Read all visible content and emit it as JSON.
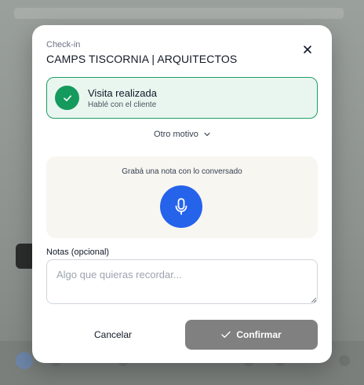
{
  "modal": {
    "eyebrow": "Check-in",
    "title": "CAMPS TISCORNIA | ARQUITECTOS",
    "close_icon": "close-icon"
  },
  "status": {
    "title": "Visita realizada",
    "subtitle": "Hablé con el cliente",
    "icon": "check-icon",
    "accent_color": "#159a5e"
  },
  "other_reason": {
    "label": "Otro motivo",
    "icon": "chevron-down-icon"
  },
  "voice_note": {
    "label": "Grabá una nota con lo conversado",
    "icon": "microphone-icon",
    "button_color": "#2563eb"
  },
  "notes": {
    "label": "Notas (opcional)",
    "placeholder": "Algo que quieras recordar...",
    "value": ""
  },
  "actions": {
    "cancel_label": "Cancelar",
    "confirm_label": "Confirmar",
    "confirm_icon": "check-icon",
    "confirm_color": "#808080"
  }
}
